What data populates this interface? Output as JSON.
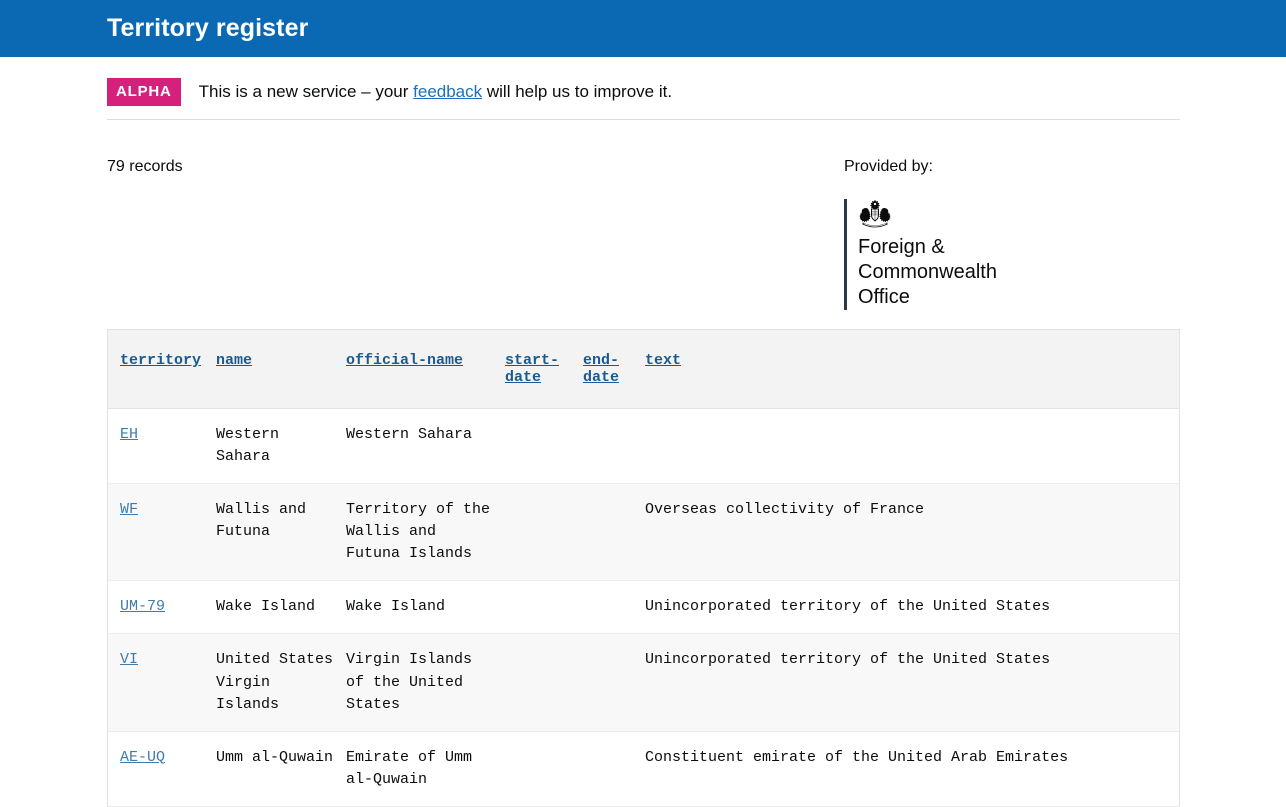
{
  "header": {
    "title": "Territory register"
  },
  "phase_banner": {
    "tag": "ALPHA",
    "text_before": "This is a new service – your ",
    "link_label": "feedback",
    "text_after": " will help us to improve it."
  },
  "meta": {
    "records_label": "79 records",
    "provided_by_label": "Provided by:",
    "provider_name": "Foreign & Commonwealth Office",
    "crest_alt": "royal-crest"
  },
  "colors": {
    "header_blue": "#0b69b4",
    "alpha_pink": "#d5217c",
    "link_blue": "#1d70b8",
    "table_link_blue": "#3f7cad",
    "header_link_blue": "#1a5a92",
    "row_alt_grey": "#f8f8f8",
    "thead_grey": "#f3f3f3",
    "provider_bar": "#2b3a42"
  },
  "table": {
    "columns": [
      {
        "key": "territory",
        "label": "territory"
      },
      {
        "key": "name",
        "label": "name"
      },
      {
        "key": "official-name",
        "label": "official-name"
      },
      {
        "key": "start-date",
        "label": "start-date"
      },
      {
        "key": "end-date",
        "label": "end-date"
      },
      {
        "key": "text",
        "label": "text"
      }
    ],
    "rows": [
      {
        "territory": "EH",
        "name": "Western Sahara",
        "official_name": "Western Sahara",
        "start_date": "",
        "end_date": "",
        "text": ""
      },
      {
        "territory": "WF",
        "name": "Wallis and Futuna",
        "official_name": "Territory of the Wallis and Futuna Islands",
        "start_date": "",
        "end_date": "",
        "text": "Overseas collectivity of France"
      },
      {
        "territory": "UM-79",
        "name": "Wake Island",
        "official_name": "Wake Island",
        "start_date": "",
        "end_date": "",
        "text": "Unincorporated territory of the United States"
      },
      {
        "territory": "VI",
        "name": "United States Virgin Islands",
        "official_name": "Virgin Islands of the United States",
        "start_date": "",
        "end_date": "",
        "text": "Unincorporated territory of the United States"
      },
      {
        "territory": "AE-UQ",
        "name": "Umm al-Quwain",
        "official_name": "Emirate of Umm al-Quwain",
        "start_date": "",
        "end_date": "",
        "text": "Constituent emirate of the United Arab Emirates"
      }
    ]
  }
}
